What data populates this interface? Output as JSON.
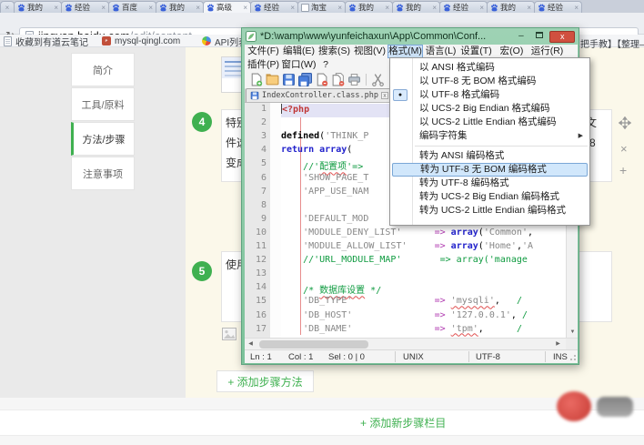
{
  "browser": {
    "tabs": [
      {
        "label": "",
        "kind": "stub"
      },
      {
        "label": "我的",
        "icon": "baidu"
      },
      {
        "label": "经验",
        "icon": "baidu"
      },
      {
        "label": "百度",
        "icon": "baidu"
      },
      {
        "label": "我的",
        "icon": "baidu"
      },
      {
        "label": "高级",
        "icon": "baidu",
        "active": true
      },
      {
        "label": "经验",
        "icon": "baidu"
      },
      {
        "label": "淘宝",
        "icon": "page"
      },
      {
        "label": "我的",
        "icon": "baidu"
      },
      {
        "label": "我的",
        "icon": "baidu"
      },
      {
        "label": "经验",
        "icon": "baidu"
      },
      {
        "label": "我的",
        "icon": "baidu"
      },
      {
        "label": "经验",
        "icon": "baidu"
      }
    ],
    "address": {
      "host": "jingyan.baidu.com",
      "path": "/edit/content"
    },
    "bookmarks": [
      {
        "label": "收藏到有道云笔记",
        "icon": "page"
      },
      {
        "label": "mysql-qingl.com",
        "icon": "pma"
      },
      {
        "label": "API列表 - 腾讯开",
        "icon": "api"
      }
    ],
    "bookmark_fragment": "把手教】【整理—"
  },
  "page": {
    "sidebar": [
      {
        "label": "简介",
        "active": false
      },
      {
        "label": "工具/原料",
        "active": false
      },
      {
        "label": "方法/步骤",
        "active": true
      },
      {
        "label": "注意事项",
        "active": false
      }
    ],
    "step4": {
      "number": "4",
      "left_lines": [
        "特别",
        "件选",
        "变成"
      ],
      "right_lines": [
        "文",
        "-8"
      ]
    },
    "step5": {
      "number": "5",
      "left_lines": [
        "使用"
      ],
      "right_lines": []
    },
    "add_method_button": "+ 添加步骤方法",
    "add_section_button": "+ 添加新步骤栏目"
  },
  "notepad": {
    "title": "*D:\\wamp\\www\\yunfeichaxun\\App\\Common\\Conf...",
    "close_glyph": "x",
    "menu_row1": [
      {
        "label": "文件(F)"
      },
      {
        "label": "编辑(E)"
      },
      {
        "label": "搜索(S)"
      },
      {
        "label": "视图(V)"
      },
      {
        "label": "格式(M)",
        "active": true
      },
      {
        "label": "语言(L)"
      },
      {
        "label": "设置(T)"
      },
      {
        "label": "宏(O)"
      },
      {
        "label": "运行(R)"
      }
    ],
    "menu_row2": [
      {
        "label": "插件(P)"
      },
      {
        "label": "窗口(W)"
      },
      {
        "label": "?",
        "q": true
      }
    ],
    "toolbar_icons": [
      "new-file",
      "open-folder",
      "save",
      "save-all",
      "close-doc",
      "close-all",
      "print",
      "divider",
      "cut"
    ],
    "doc_tabs": [
      {
        "label": "IndexController.class.php",
        "active": true,
        "close": "x"
      },
      {
        "label": "",
        "partial": true
      }
    ],
    "format_menu": [
      {
        "label": "以 ANSI 格式编码"
      },
      {
        "label": "以 UTF-8 无 BOM 格式编码"
      },
      {
        "label": "以 UTF-8 格式编码",
        "radio": true
      },
      {
        "label": "以 UCS-2 Big Endian 格式编码"
      },
      {
        "label": "以 UCS-2 Little Endian 格式编码"
      },
      {
        "label": "编码字符集",
        "submenu": true
      },
      {
        "separator": true
      },
      {
        "label": "转为 ANSI 编码格式"
      },
      {
        "label": "转为 UTF-8 无 BOM 编码格式",
        "hover": true
      },
      {
        "label": "转为 UTF-8 编码格式"
      },
      {
        "label": "转为 UCS-2 Big Endian 编码格式"
      },
      {
        "label": "转为 UCS-2 Little Endian 编码格式"
      }
    ],
    "editor_lines": [
      {
        "n": "1",
        "current": true,
        "seg": [
          {
            "t": "<?php",
            "c": "tag"
          }
        ]
      },
      {
        "n": "2",
        "seg": []
      },
      {
        "n": "3",
        "seg": [
          {
            "t": "defined",
            "c": "kwbold"
          },
          {
            "t": "(",
            "c": "pln"
          },
          {
            "t": "'THINK_P",
            "c": "str"
          }
        ]
      },
      {
        "n": "4",
        "seg": [
          {
            "t": "return array",
            "c": "kwblue"
          },
          {
            "t": "(",
            "c": "pln"
          }
        ]
      },
      {
        "n": "5",
        "seg": [
          {
            "t": "    ",
            "c": "pln"
          },
          {
            "t": "//'",
            "c": "cmt"
          },
          {
            "t": "配置项",
            "c": "cmt sq"
          },
          {
            "t": "'=>",
            "c": "cmt"
          }
        ]
      },
      {
        "n": "6",
        "seg": [
          {
            "t": "    ",
            "c": "pln"
          },
          {
            "t": "'SHOW_PAGE_T",
            "c": "str"
          }
        ]
      },
      {
        "n": "7",
        "seg": [
          {
            "t": "    ",
            "c": "pln"
          },
          {
            "t": "'APP_USE_NAM",
            "c": "str"
          }
        ]
      },
      {
        "n": "8",
        "seg": []
      },
      {
        "n": "9",
        "seg": [
          {
            "t": "    ",
            "c": "pln"
          },
          {
            "t": "'DEFAULT_MOD",
            "c": "str"
          }
        ]
      },
      {
        "n": "10",
        "seg": [
          {
            "t": "    ",
            "c": "pln"
          },
          {
            "t": "'MODULE_DENY_LIST'",
            "c": "str"
          },
          {
            "t": "      ",
            "c": "pln"
          },
          {
            "t": "=>",
            "c": "op"
          },
          {
            "t": " ",
            "c": "pln"
          },
          {
            "t": "array",
            "c": "kwblue"
          },
          {
            "t": "(",
            "c": "pln"
          },
          {
            "t": "'Common'",
            "c": "str"
          },
          {
            "t": ",",
            "c": "pln"
          }
        ]
      },
      {
        "n": "11",
        "seg": [
          {
            "t": "    ",
            "c": "pln"
          },
          {
            "t": "'MODULE_ALLOW_LIST'",
            "c": "str"
          },
          {
            "t": "     ",
            "c": "pln"
          },
          {
            "t": "=>",
            "c": "op"
          },
          {
            "t": " ",
            "c": "pln"
          },
          {
            "t": "array",
            "c": "kwblue"
          },
          {
            "t": "(",
            "c": "pln"
          },
          {
            "t": "'Home'",
            "c": "str"
          },
          {
            "t": ",",
            "c": "pln"
          },
          {
            "t": "'A",
            "c": "str"
          }
        ]
      },
      {
        "n": "12",
        "seg": [
          {
            "t": "    ",
            "c": "pln"
          },
          {
            "t": "//'URL_MODULE_MAP'       => array('manage",
            "c": "cmt"
          }
        ]
      },
      {
        "n": "13",
        "seg": []
      },
      {
        "n": "14",
        "seg": [
          {
            "t": "    ",
            "c": "pln"
          },
          {
            "t": "/* ",
            "c": "cmt"
          },
          {
            "t": "数据库设置",
            "c": "cmt sq"
          },
          {
            "t": " */",
            "c": "cmt"
          }
        ]
      },
      {
        "n": "15",
        "seg": [
          {
            "t": "    ",
            "c": "pln"
          },
          {
            "t": "'DB_TYPE'",
            "c": "str"
          },
          {
            "t": "               ",
            "c": "pln"
          },
          {
            "t": "=>",
            "c": "op"
          },
          {
            "t": " ",
            "c": "pln"
          },
          {
            "t": "'mysqli'",
            "c": "str sq"
          },
          {
            "t": ",   ",
            "c": "pln"
          },
          {
            "t": "/",
            "c": "cmt"
          }
        ]
      },
      {
        "n": "16",
        "seg": [
          {
            "t": "    ",
            "c": "pln"
          },
          {
            "t": "'DB_HOST'",
            "c": "str"
          },
          {
            "t": "               ",
            "c": "pln"
          },
          {
            "t": "=>",
            "c": "op"
          },
          {
            "t": " ",
            "c": "pln"
          },
          {
            "t": "'127.0.0.1'",
            "c": "str"
          },
          {
            "t": ", ",
            "c": "pln"
          },
          {
            "t": "/",
            "c": "cmt"
          }
        ]
      },
      {
        "n": "17",
        "seg": [
          {
            "t": "    ",
            "c": "pln"
          },
          {
            "t": "'DB_NAME'",
            "c": "str"
          },
          {
            "t": "               ",
            "c": "pln"
          },
          {
            "t": "=>",
            "c": "op"
          },
          {
            "t": " ",
            "c": "pln"
          },
          {
            "t": "'tpm'",
            "c": "str sq"
          },
          {
            "t": ",      ",
            "c": "pln"
          },
          {
            "t": "/",
            "c": "cmt"
          }
        ]
      }
    ],
    "status": {
      "ln": "Ln : 1",
      "col": "Col : 1",
      "sel": "Sel : 0 | 0",
      "eol": "UNIX",
      "enc": "UTF-8",
      "mode": "INS"
    }
  },
  "colors": {
    "accent_green": "#3fb050",
    "window_green": "#7cc29a",
    "close_red": "#d0503f"
  }
}
